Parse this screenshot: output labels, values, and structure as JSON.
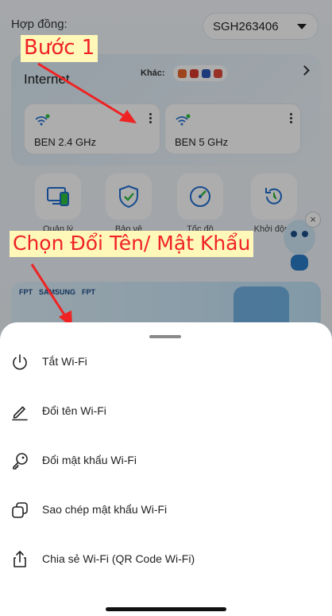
{
  "header": {
    "contract_label": "Hợp đồng:",
    "contract_id": "SGH263406"
  },
  "internet": {
    "title": "Internet",
    "other_label": "Khác:",
    "wifi": [
      {
        "ssid": "BEN 2.4 GHz"
      },
      {
        "ssid": "BEN 5 GHz"
      }
    ]
  },
  "quick_actions": [
    {
      "icon": "devices-icon",
      "label": "Quản lý"
    },
    {
      "icon": "shield-check-icon",
      "label": "Bảo vệ"
    },
    {
      "icon": "speedometer-icon",
      "label": "Tốc độ"
    },
    {
      "icon": "restart-icon",
      "label": "Khởi động"
    }
  ],
  "banner": {
    "brands": [
      "FPT",
      "SAMSUNG",
      "FPT"
    ]
  },
  "annotations": {
    "step1": "Bước 1",
    "choose": "Chọn Đổi Tên/ Mật Khẩu"
  },
  "sheet": {
    "items": [
      {
        "icon": "power-icon",
        "label": "Tắt Wi-Fi"
      },
      {
        "icon": "pencil-icon",
        "label": "Đổi tên Wi-Fi"
      },
      {
        "icon": "key-icon",
        "label": "Đổi mật khẩu Wi-Fi"
      },
      {
        "icon": "copy-icon",
        "label": "Sao chép mật khẩu Wi-Fi"
      },
      {
        "icon": "share-icon",
        "label": "Chia sẻ Wi-Fi (QR Code Wi-Fi)"
      }
    ]
  },
  "colors": {
    "annotation_text": "#ef2323",
    "annotation_bg": "#fff8b8",
    "wifi_green": "#2fbf3f",
    "accent_blue": "#1f6fd1"
  }
}
